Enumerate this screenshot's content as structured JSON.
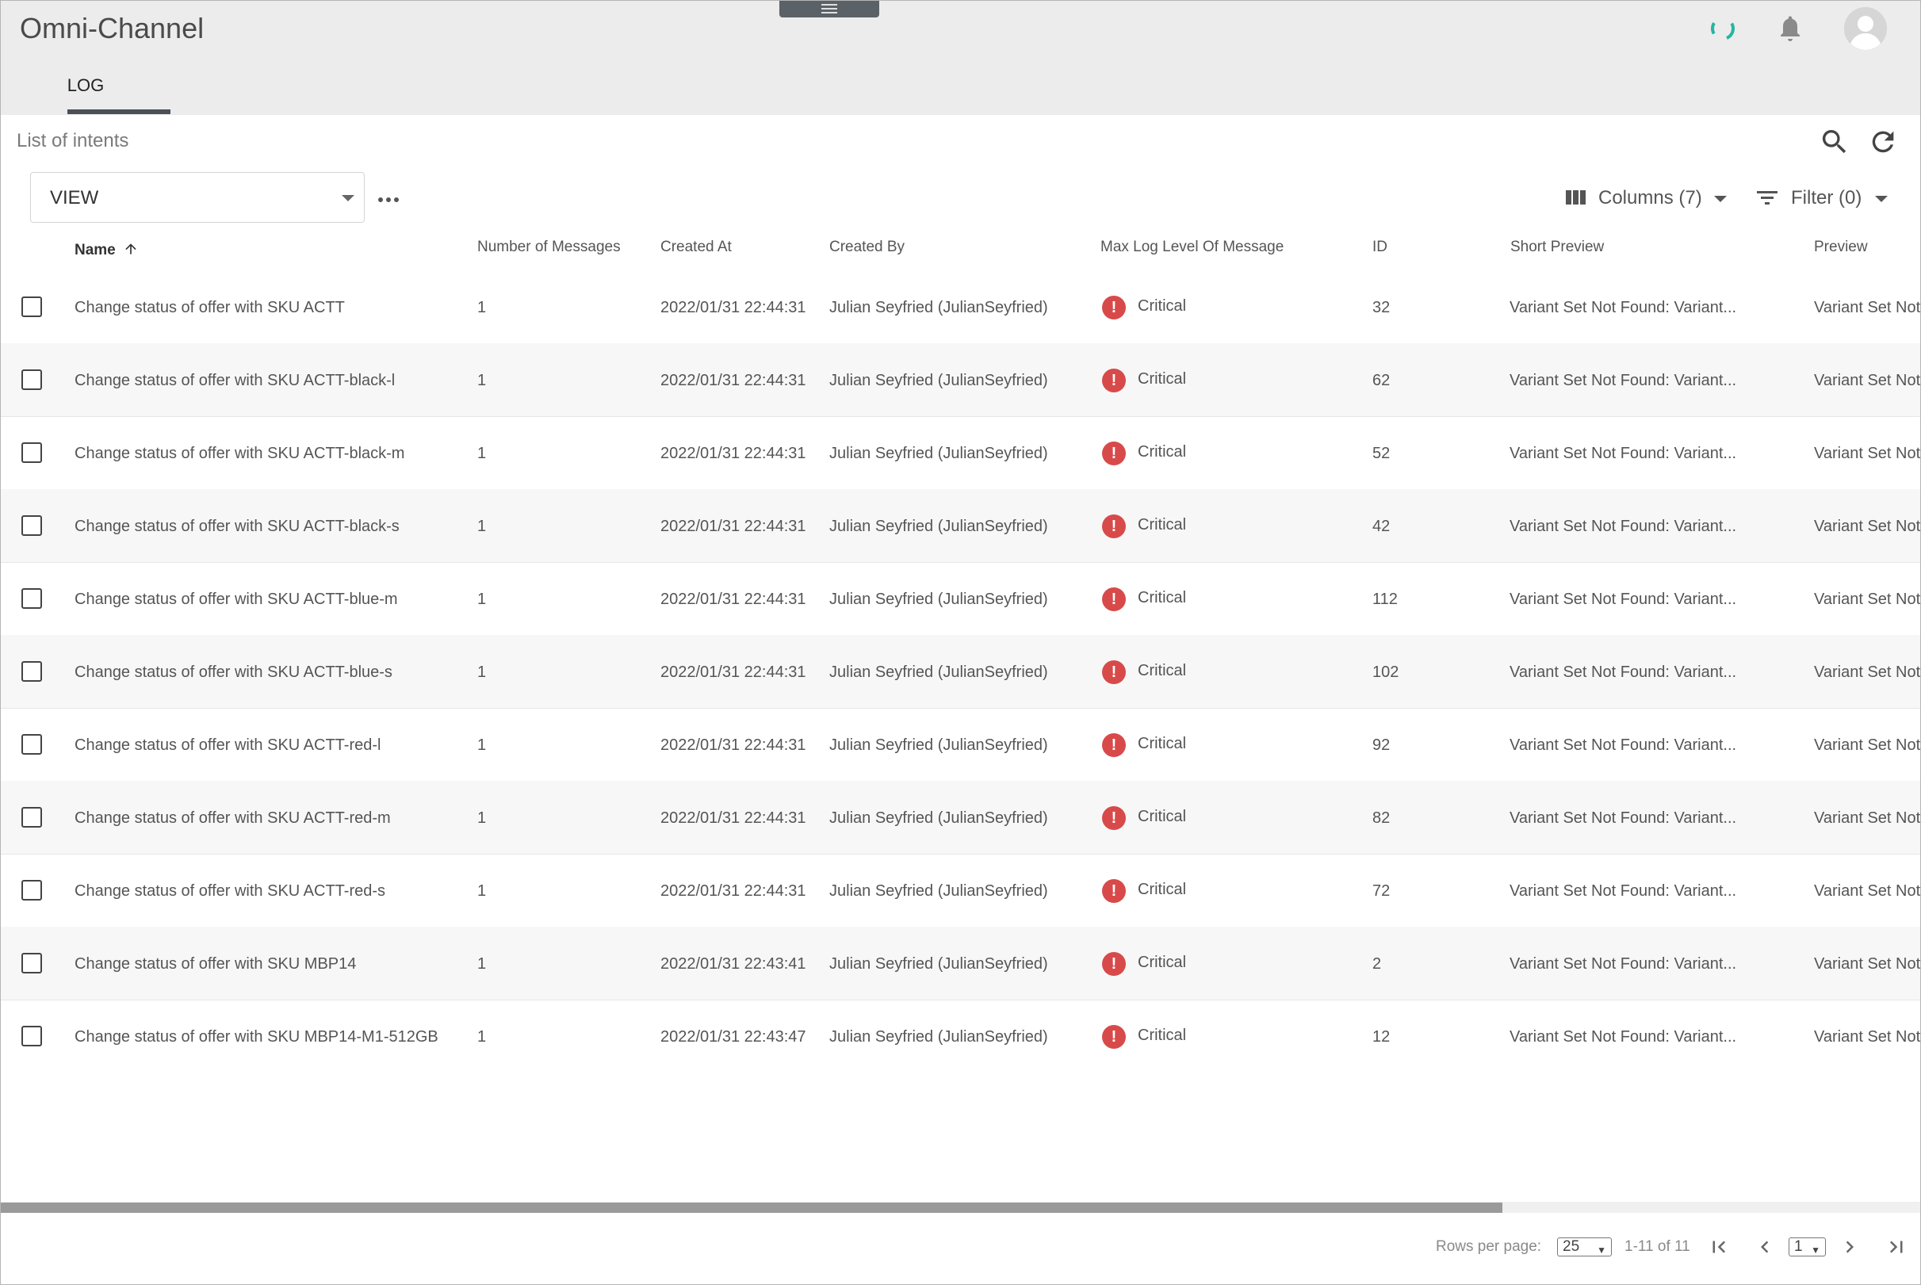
{
  "app": {
    "title": "Omni-Channel"
  },
  "tabs": [
    {
      "label": "LOG",
      "active": true
    }
  ],
  "list": {
    "title": "List of intents"
  },
  "toolbar": {
    "view_label": "VIEW",
    "columns_label": "Columns (7)",
    "filter_label": "Filter (0)"
  },
  "columns": {
    "name": "Name",
    "messages": "Number of Messages",
    "created_at": "Created At",
    "created_by": "Created By",
    "max_level": "Max Log Level Of Message",
    "id": "ID",
    "short_preview": "Short Preview",
    "preview": "Preview"
  },
  "rows": [
    {
      "name": "Change status of offer with SKU ACTT",
      "messages": "1",
      "created_at": "2022/01/31 22:44:31",
      "created_by": "Julian Seyfried (JulianSeyfried)",
      "level": "Critical",
      "id": "32",
      "short_preview": "Variant Set Not Found: Variant...",
      "preview": "Variant Set Not"
    },
    {
      "name": "Change status of offer with SKU ACTT-black-l",
      "messages": "1",
      "created_at": "2022/01/31 22:44:31",
      "created_by": "Julian Seyfried (JulianSeyfried)",
      "level": "Critical",
      "id": "62",
      "short_preview": "Variant Set Not Found: Variant...",
      "preview": "Variant Set Not"
    },
    {
      "name": "Change status of offer with SKU ACTT-black-m",
      "messages": "1",
      "created_at": "2022/01/31 22:44:31",
      "created_by": "Julian Seyfried (JulianSeyfried)",
      "level": "Critical",
      "id": "52",
      "short_preview": "Variant Set Not Found: Variant...",
      "preview": "Variant Set Not"
    },
    {
      "name": "Change status of offer with SKU ACTT-black-s",
      "messages": "1",
      "created_at": "2022/01/31 22:44:31",
      "created_by": "Julian Seyfried (JulianSeyfried)",
      "level": "Critical",
      "id": "42",
      "short_preview": "Variant Set Not Found: Variant...",
      "preview": "Variant Set Not"
    },
    {
      "name": "Change status of offer with SKU ACTT-blue-m",
      "messages": "1",
      "created_at": "2022/01/31 22:44:31",
      "created_by": "Julian Seyfried (JulianSeyfried)",
      "level": "Critical",
      "id": "112",
      "short_preview": "Variant Set Not Found: Variant...",
      "preview": "Variant Set Not"
    },
    {
      "name": "Change status of offer with SKU ACTT-blue-s",
      "messages": "1",
      "created_at": "2022/01/31 22:44:31",
      "created_by": "Julian Seyfried (JulianSeyfried)",
      "level": "Critical",
      "id": "102",
      "short_preview": "Variant Set Not Found: Variant...",
      "preview": "Variant Set Not"
    },
    {
      "name": "Change status of offer with SKU ACTT-red-l",
      "messages": "1",
      "created_at": "2022/01/31 22:44:31",
      "created_by": "Julian Seyfried (JulianSeyfried)",
      "level": "Critical",
      "id": "92",
      "short_preview": "Variant Set Not Found: Variant...",
      "preview": "Variant Set Not"
    },
    {
      "name": "Change status of offer with SKU ACTT-red-m",
      "messages": "1",
      "created_at": "2022/01/31 22:44:31",
      "created_by": "Julian Seyfried (JulianSeyfried)",
      "level": "Critical",
      "id": "82",
      "short_preview": "Variant Set Not Found: Variant...",
      "preview": "Variant Set Not"
    },
    {
      "name": "Change status of offer with SKU ACTT-red-s",
      "messages": "1",
      "created_at": "2022/01/31 22:44:31",
      "created_by": "Julian Seyfried (JulianSeyfried)",
      "level": "Critical",
      "id": "72",
      "short_preview": "Variant Set Not Found: Variant...",
      "preview": "Variant Set Not"
    },
    {
      "name": "Change status of offer with SKU MBP14",
      "messages": "1",
      "created_at": "2022/01/31 22:43:41",
      "created_by": "Julian Seyfried (JulianSeyfried)",
      "level": "Critical",
      "id": "2",
      "short_preview": "Variant Set Not Found: Variant...",
      "preview": "Variant Set Not"
    },
    {
      "name": "Change status of offer with SKU MBP14-M1-512GB",
      "messages": "1",
      "created_at": "2022/01/31 22:43:47",
      "created_by": "Julian Seyfried (JulianSeyfried)",
      "level": "Critical",
      "id": "12",
      "short_preview": "Variant Set Not Found: Variant...",
      "preview": "Variant Set Not"
    }
  ],
  "footer": {
    "rows_per_page_label": "Rows per page:",
    "rows_per_page_value": "25",
    "range_label": "1-11 of 11",
    "page_value": "1"
  },
  "colors": {
    "accent": "#26b5a0",
    "critical": "#d84a4a",
    "header_bg": "#ececec"
  },
  "icons": [
    "spinner-icon",
    "bell-icon",
    "avatar-icon",
    "search-icon",
    "refresh-icon",
    "columns-icon",
    "filter-icon",
    "more-horiz-icon",
    "sort-arrow-up-icon",
    "critical-icon",
    "first-page-icon",
    "prev-page-icon",
    "next-page-icon",
    "last-page-icon"
  ]
}
